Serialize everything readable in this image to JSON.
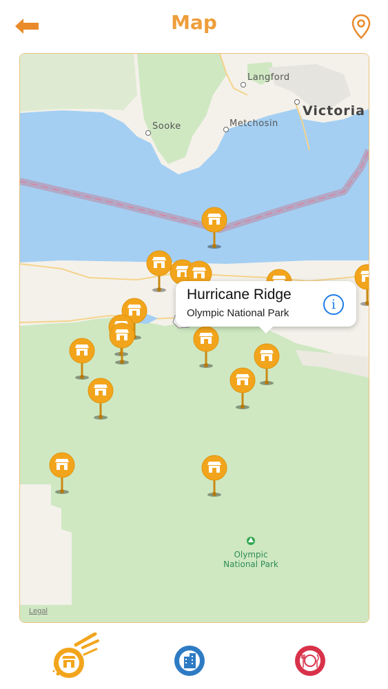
{
  "header": {
    "title": "Map",
    "back_icon": "back-arrow-icon",
    "location_icon": "map-pin-icon",
    "accent_color": "#EE9E3B"
  },
  "map": {
    "labels": {
      "langford": "Langford",
      "victoria": "Victoria",
      "sooke": "Sooke",
      "metchosin": "Metchosin",
      "park_line1": "Olympic",
      "park_line2": "National Park"
    },
    "legal": "Legal",
    "pin_icon": "shop-pin-icon",
    "callout": {
      "title": "Hurricane Ridge",
      "subtitle": "Olympic National Park",
      "info_icon": "info-icon",
      "info_glyph": "i"
    },
    "colors": {
      "water": "#A4CFF3",
      "land": "#F4F1EA",
      "park": "#CFE8C2",
      "pin": "#F2A51C"
    }
  },
  "tabbar": {
    "tabs": [
      {
        "name": "shops",
        "icon": "shop-icon",
        "color": "#F2A51C"
      },
      {
        "name": "city",
        "icon": "building-icon",
        "color": "#2E7BC4"
      },
      {
        "name": "restaurants",
        "icon": "plate-cutlery-icon",
        "color": "#D8324A"
      }
    ]
  }
}
